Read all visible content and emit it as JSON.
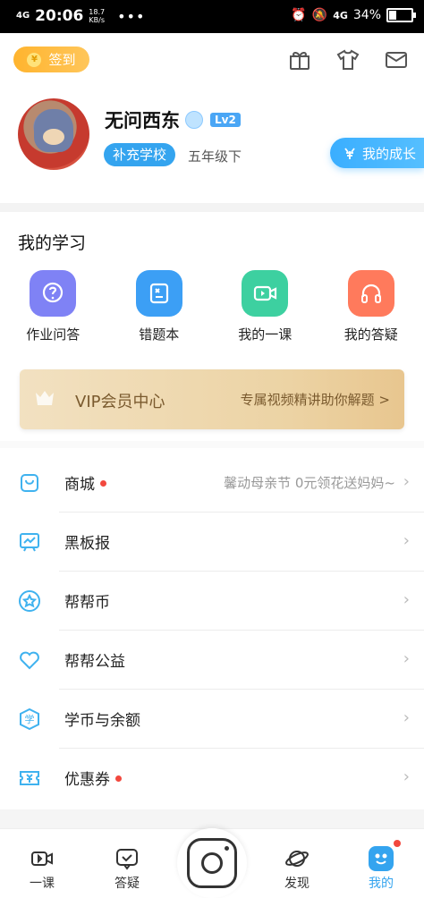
{
  "status_bar": {
    "signal": "4G",
    "time": "20:06",
    "speed_value": "18.7",
    "speed_unit": "KB/s",
    "dots": "•••",
    "network": "4G",
    "battery": "34%",
    "battery_level": 0.34
  },
  "header": {
    "checkin_label": "签到",
    "coin_glyph": "¥"
  },
  "profile": {
    "name": "无问西东",
    "level": "Lv2",
    "school_button": "补充学校",
    "grade": "五年级下",
    "growth_button": "我的成长"
  },
  "learning": {
    "title": "我的学习",
    "items": [
      {
        "label": "作业问答",
        "color": "#7f82f5"
      },
      {
        "label": "错题本",
        "color": "#3c9ff5"
      },
      {
        "label": "我的一课",
        "color": "#3dd0a0"
      },
      {
        "label": "我的答疑",
        "color": "#ff7a5c"
      }
    ]
  },
  "vip": {
    "title": "VIP会员中心",
    "subtitle": "专属视频精讲助你解题 >"
  },
  "menu": [
    {
      "label": "商城",
      "extra": "馨动母亲节 0元领花送妈妈~",
      "dot": true
    },
    {
      "label": "黑板报",
      "extra": "",
      "dot": false
    },
    {
      "label": "帮帮币",
      "extra": "",
      "dot": false
    },
    {
      "label": "帮帮公益",
      "extra": "",
      "dot": false
    },
    {
      "label": "学币与余额",
      "extra": "",
      "dot": false
    },
    {
      "label": "优惠券",
      "extra": "",
      "dot": true
    }
  ],
  "tabs": [
    {
      "label": "一课"
    },
    {
      "label": "答疑"
    },
    {
      "label": "发现"
    },
    {
      "label": "我的"
    }
  ],
  "colors": {
    "accent": "#34a4ef",
    "checkin": "#ffb42e",
    "vip_text": "#7a5a2e",
    "dot": "#f2483e"
  }
}
